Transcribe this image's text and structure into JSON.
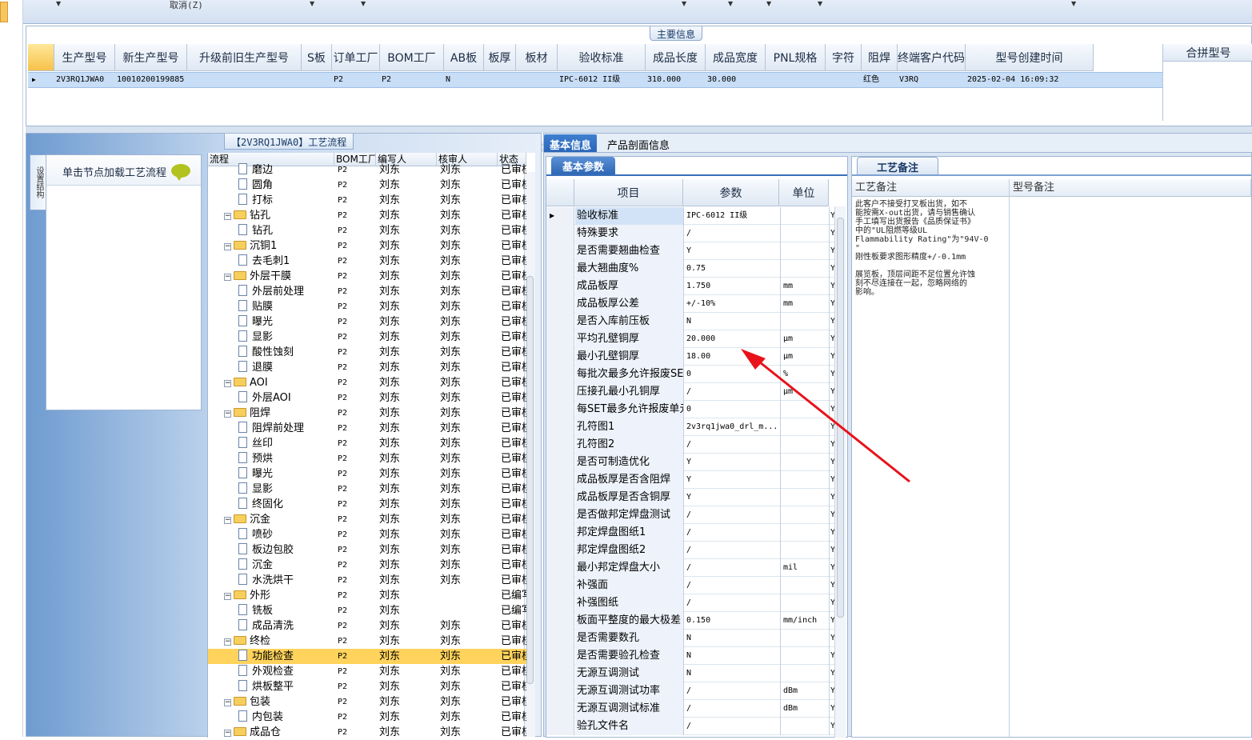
{
  "toolbar": {
    "cancel_label": "取消(Z)"
  },
  "main_info": {
    "caption": "主要信息",
    "columns": [
      "生产型号",
      "新生产型号",
      "升级前旧生产型号",
      "S板",
      "订单工厂",
      "BOM工厂",
      "AB板",
      "板厚",
      "板材",
      "验收标准",
      "成品长度",
      "成品宽度",
      "PNL规格",
      "字符",
      "阻焊",
      "终端客户代码",
      "型号创建时间"
    ],
    "row": [
      "2V3RQ1JWA0",
      "10010200199885",
      "",
      "",
      "P2",
      "P2",
      "N",
      "",
      "",
      "IPC-6012 II级",
      "310.000",
      "30.000",
      "",
      "",
      "红色",
      "V3RQ",
      "2025-02-04 16:09:32"
    ],
    "merge_header": "合拼型号"
  },
  "flow": {
    "caption": "【2V3RQ1JWA0】工艺流程",
    "side_tab": "设置结构",
    "click_hint": "单击节点加载工艺流程",
    "columns": [
      "流程",
      "BOM工厂",
      "编写人",
      "核审人",
      "状态"
    ],
    "rows": [
      {
        "name": "磨边",
        "level": 2,
        "type": "doc",
        "bom": "P2",
        "writer": "刘东",
        "reviewer": "刘东",
        "status": "已审核"
      },
      {
        "name": "圆角",
        "level": 2,
        "type": "doc",
        "bom": "P2",
        "writer": "刘东",
        "reviewer": "刘东",
        "status": "已审核"
      },
      {
        "name": "打标",
        "level": 2,
        "type": "doc",
        "bom": "P2",
        "writer": "刘东",
        "reviewer": "刘东",
        "status": "已审核"
      },
      {
        "name": "钻孔",
        "level": 1,
        "type": "folder",
        "bom": "P2",
        "writer": "刘东",
        "reviewer": "刘东",
        "status": "已审核"
      },
      {
        "name": "钻孔",
        "level": 2,
        "type": "doc",
        "bom": "P2",
        "writer": "刘东",
        "reviewer": "刘东",
        "status": "已审核"
      },
      {
        "name": "沉铜1",
        "level": 1,
        "type": "folder",
        "bom": "P2",
        "writer": "刘东",
        "reviewer": "刘东",
        "status": "已审核"
      },
      {
        "name": "去毛刺1",
        "level": 2,
        "type": "doc",
        "bom": "P2",
        "writer": "刘东",
        "reviewer": "刘东",
        "status": "已审核"
      },
      {
        "name": "外层干膜",
        "level": 1,
        "type": "folder",
        "bom": "P2",
        "writer": "刘东",
        "reviewer": "刘东",
        "status": "已审核"
      },
      {
        "name": "外层前处理",
        "level": 2,
        "type": "doc",
        "bom": "P2",
        "writer": "刘东",
        "reviewer": "刘东",
        "status": "已审核"
      },
      {
        "name": "贴膜",
        "level": 2,
        "type": "doc",
        "bom": "P2",
        "writer": "刘东",
        "reviewer": "刘东",
        "status": "已审核"
      },
      {
        "name": "曝光",
        "level": 2,
        "type": "doc",
        "bom": "P2",
        "writer": "刘东",
        "reviewer": "刘东",
        "status": "已审核"
      },
      {
        "name": "显影",
        "level": 2,
        "type": "doc",
        "bom": "P2",
        "writer": "刘东",
        "reviewer": "刘东",
        "status": "已审核"
      },
      {
        "name": "酸性蚀刻",
        "level": 2,
        "type": "doc",
        "bom": "P2",
        "writer": "刘东",
        "reviewer": "刘东",
        "status": "已审核"
      },
      {
        "name": "退膜",
        "level": 2,
        "type": "doc",
        "bom": "P2",
        "writer": "刘东",
        "reviewer": "刘东",
        "status": "已审核"
      },
      {
        "name": "AOI",
        "level": 1,
        "type": "folder",
        "bom": "P2",
        "writer": "刘东",
        "reviewer": "刘东",
        "status": "已审核"
      },
      {
        "name": "外层AOI",
        "level": 2,
        "type": "doc",
        "bom": "P2",
        "writer": "刘东",
        "reviewer": "刘东",
        "status": "已审核"
      },
      {
        "name": "阻焊",
        "level": 1,
        "type": "folder",
        "bom": "P2",
        "writer": "刘东",
        "reviewer": "刘东",
        "status": "已审核"
      },
      {
        "name": "阻焊前处理",
        "level": 2,
        "type": "doc",
        "bom": "P2",
        "writer": "刘东",
        "reviewer": "刘东",
        "status": "已审核"
      },
      {
        "name": "丝印",
        "level": 2,
        "type": "doc",
        "bom": "P2",
        "writer": "刘东",
        "reviewer": "刘东",
        "status": "已审核"
      },
      {
        "name": "预烘",
        "level": 2,
        "type": "doc",
        "bom": "P2",
        "writer": "刘东",
        "reviewer": "刘东",
        "status": "已审核"
      },
      {
        "name": "曝光",
        "level": 2,
        "type": "doc",
        "bom": "P2",
        "writer": "刘东",
        "reviewer": "刘东",
        "status": "已审核"
      },
      {
        "name": "显影",
        "level": 2,
        "type": "doc",
        "bom": "P2",
        "writer": "刘东",
        "reviewer": "刘东",
        "status": "已审核"
      },
      {
        "name": "终固化",
        "level": 2,
        "type": "doc",
        "bom": "P2",
        "writer": "刘东",
        "reviewer": "刘东",
        "status": "已审核"
      },
      {
        "name": "沉金",
        "level": 1,
        "type": "folder",
        "bom": "P2",
        "writer": "刘东",
        "reviewer": "刘东",
        "status": "已审核"
      },
      {
        "name": "喷砂",
        "level": 2,
        "type": "doc",
        "bom": "P2",
        "writer": "刘东",
        "reviewer": "刘东",
        "status": "已审核"
      },
      {
        "name": "板边包胶",
        "level": 2,
        "type": "doc",
        "bom": "P2",
        "writer": "刘东",
        "reviewer": "刘东",
        "status": "已审核"
      },
      {
        "name": "沉金",
        "level": 2,
        "type": "doc",
        "bom": "P2",
        "writer": "刘东",
        "reviewer": "刘东",
        "status": "已审核"
      },
      {
        "name": "水洗烘干",
        "level": 2,
        "type": "doc",
        "bom": "P2",
        "writer": "刘东",
        "reviewer": "刘东",
        "status": "已审核"
      },
      {
        "name": "外形",
        "level": 1,
        "type": "folder",
        "bom": "P2",
        "writer": "刘东",
        "reviewer": "",
        "status": "已编写"
      },
      {
        "name": "铣板",
        "level": 2,
        "type": "doc",
        "bom": "P2",
        "writer": "刘东",
        "reviewer": "",
        "status": "已编写"
      },
      {
        "name": "成品清洗",
        "level": 2,
        "type": "doc",
        "bom": "P2",
        "writer": "刘东",
        "reviewer": "刘东",
        "status": "已审核"
      },
      {
        "name": "终检",
        "level": 1,
        "type": "folder",
        "bom": "P2",
        "writer": "刘东",
        "reviewer": "刘东",
        "status": "已审核"
      },
      {
        "name": "功能检查",
        "level": 2,
        "type": "doc",
        "bom": "P2",
        "writer": "刘东",
        "reviewer": "刘东",
        "status": "已审核",
        "selected": true
      },
      {
        "name": "外观检查",
        "level": 2,
        "type": "doc",
        "bom": "P2",
        "writer": "刘东",
        "reviewer": "刘东",
        "status": "已审核"
      },
      {
        "name": "烘板整平",
        "level": 2,
        "type": "doc",
        "bom": "P2",
        "writer": "刘东",
        "reviewer": "刘东",
        "status": "已审核"
      },
      {
        "name": "包装",
        "level": 1,
        "type": "folder",
        "bom": "P2",
        "writer": "刘东",
        "reviewer": "刘东",
        "status": "已审核"
      },
      {
        "name": "内包装",
        "level": 2,
        "type": "doc",
        "bom": "P2",
        "writer": "刘东",
        "reviewer": "刘东",
        "status": "已审核"
      },
      {
        "name": "成品仓",
        "level": 1,
        "type": "folder",
        "bom": "P2",
        "writer": "刘东",
        "reviewer": "刘东",
        "status": "已审核"
      }
    ]
  },
  "tabs": [
    "基本信息",
    "产品剖面信息"
  ],
  "params": {
    "caption": "基本参数",
    "columns": [
      "项目",
      "参数",
      "单位"
    ],
    "rows": [
      {
        "item": "验收标准",
        "value": "IPC-6012 II级",
        "unit": "",
        "flag": "Y"
      },
      {
        "item": "特殊要求",
        "value": "/",
        "unit": "",
        "flag": "Y"
      },
      {
        "item": "是否需要翘曲检查",
        "value": "Y",
        "unit": "",
        "flag": "Y"
      },
      {
        "item": "最大翘曲度%",
        "value": "0.75",
        "unit": "",
        "flag": "Y"
      },
      {
        "item": "成品板厚",
        "value": "1.750",
        "unit": "mm",
        "flag": "Y"
      },
      {
        "item": "成品板厚公差",
        "value": "+/-10%",
        "unit": "mm",
        "flag": "Y"
      },
      {
        "item": "是否入库前压板",
        "value": "N",
        "unit": "",
        "flag": "Y"
      },
      {
        "item": "平均孔壁铜厚",
        "value": "20.000",
        "unit": "μm",
        "flag": "Y"
      },
      {
        "item": "最小孔壁铜厚",
        "value": "18.00",
        "unit": "μm",
        "flag": "Y"
      },
      {
        "item": "每批次最多允许报废SET",
        "value": "0",
        "unit": "%",
        "flag": "Y"
      },
      {
        "item": "压接孔最小孔铜厚",
        "value": "/",
        "unit": "μm",
        "flag": "Y"
      },
      {
        "item": "每SET最多允许报废单元",
        "value": "0",
        "unit": "",
        "flag": "Y"
      },
      {
        "item": "孔符图1",
        "value": "2v3rq1jwa0_drl_m...",
        "unit": "",
        "flag": "Y"
      },
      {
        "item": "孔符图2",
        "value": "/",
        "unit": "",
        "flag": "Y"
      },
      {
        "item": "是否可制造优化",
        "value": "Y",
        "unit": "",
        "flag": "Y"
      },
      {
        "item": "成品板厚是否含阻焊",
        "value": "Y",
        "unit": "",
        "flag": "Y"
      },
      {
        "item": "成品板厚是否含铜厚",
        "value": "Y",
        "unit": "",
        "flag": "Y"
      },
      {
        "item": "是否做邦定焊盘测试",
        "value": "/",
        "unit": "",
        "flag": "Y"
      },
      {
        "item": "邦定焊盘图纸1",
        "value": "/",
        "unit": "",
        "flag": "Y"
      },
      {
        "item": "邦定焊盘图纸2",
        "value": "/",
        "unit": "",
        "flag": "Y"
      },
      {
        "item": "最小邦定焊盘大小",
        "value": "/",
        "unit": "mil",
        "flag": "Y"
      },
      {
        "item": "补强面",
        "value": "/",
        "unit": "",
        "flag": "Y"
      },
      {
        "item": "补强图纸",
        "value": "/",
        "unit": "",
        "flag": "Y"
      },
      {
        "item": "板面平整度的最大极差",
        "value": "0.150",
        "unit": "mm/inch",
        "flag": "Y"
      },
      {
        "item": "是否需要数孔",
        "value": "N",
        "unit": "",
        "flag": "Y"
      },
      {
        "item": "是否需要验孔检查",
        "value": "N",
        "unit": "",
        "flag": "Y"
      },
      {
        "item": "无源互调测试",
        "value": "N",
        "unit": "",
        "flag": "Y"
      },
      {
        "item": "无源互调测试功率",
        "value": "/",
        "unit": "dBm",
        "flag": "Y"
      },
      {
        "item": "无源互调测试标准",
        "value": "/",
        "unit": "dBm",
        "flag": "Y"
      },
      {
        "item": "验孔文件名",
        "value": "/",
        "unit": "",
        "flag": "Y"
      }
    ]
  },
  "notes": {
    "caption": "工艺备注",
    "col1": "工艺备注",
    "col2": "型号备注",
    "text": "此客户不接受打叉板出货，如不\n能按需X-out出货，请与销售确认\n手工填写出货报告《品质保证书》\n中的\"UL阻燃等级UL\nFlammability Rating\"为\"94V-0\n\"\n刚性板要求图形精度+/-0.1mm\n\n展览板，顶层间距不足位置允许蚀\n刻不尽连接在一起，忽略网络的\n影响。"
  },
  "colors": {
    "accent": "#2a66b8",
    "selection": "#c8ddf6",
    "tree_selected": "#ffd35c",
    "annotation_arrow": "#e8121a"
  }
}
